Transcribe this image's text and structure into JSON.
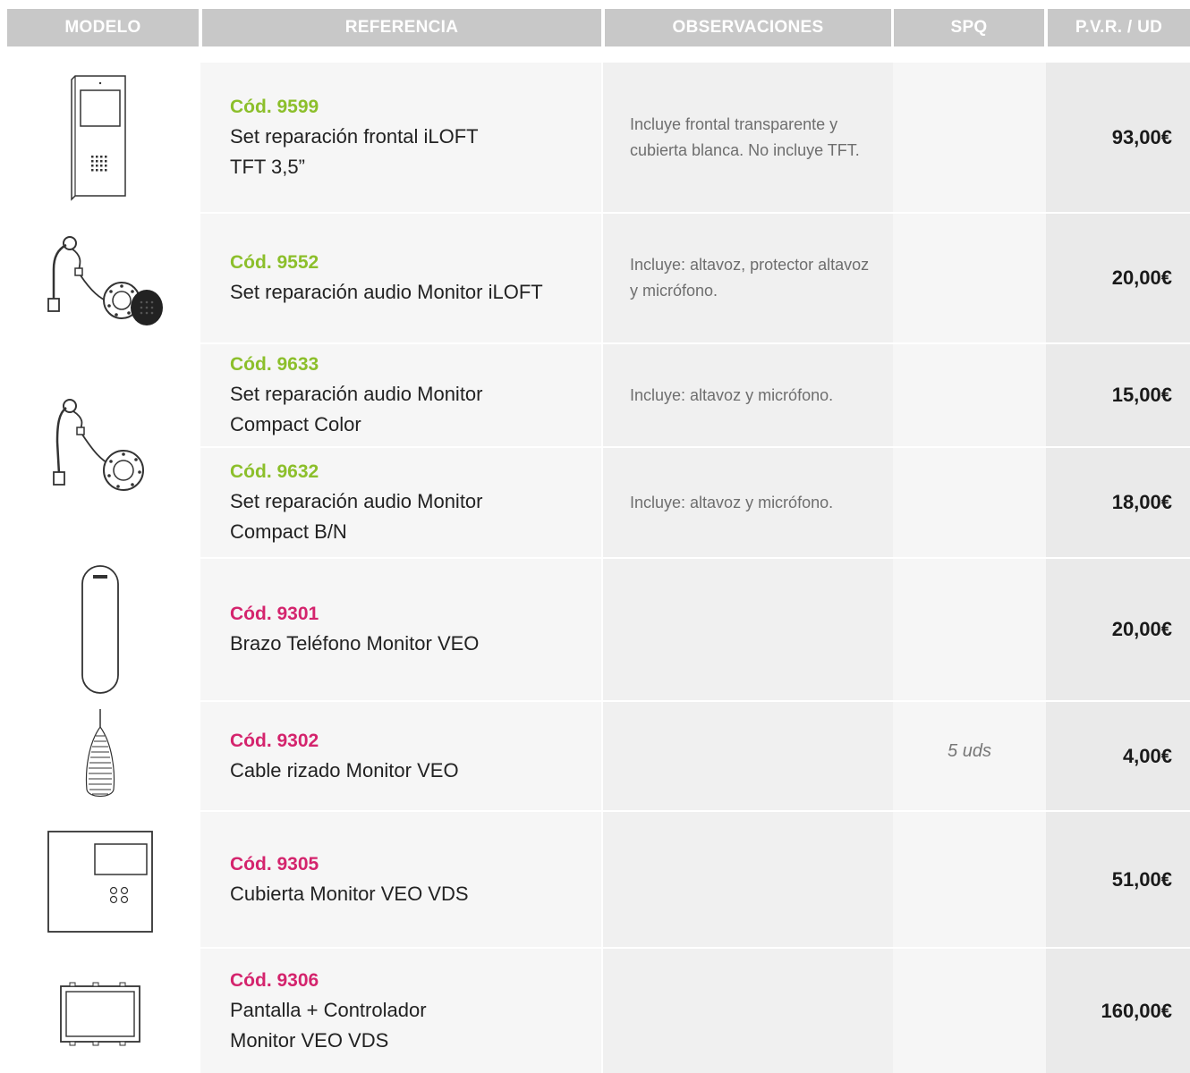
{
  "header": {
    "modelo": "MODELO",
    "referencia": "REFERENCIA",
    "observaciones": "OBSERVACIONES",
    "spq": "SPQ",
    "pvr": "P.V.R. / UD"
  },
  "colors": {
    "code_green": "#8cbf2b",
    "code_pink": "#d4246d",
    "header_bg": "#c8c8c8"
  },
  "products": [
    {
      "code": "Cód. 9599",
      "description": "Set reparación frontal iLOFT\nTFT 3,5”",
      "observations": "Incluye frontal transparente y cubierta blanca. No incluye TFT.",
      "spq": "",
      "price": "93,00€",
      "image": "front-panel-icon"
    },
    {
      "code": "Cód. 9552",
      "description": "Set reparación audio Monitor iLOFT",
      "observations": "Incluye: altavoz, protector altavoz y micrófono.",
      "spq": "",
      "price": "20,00€",
      "image": "speaker-cable-icon"
    },
    {
      "code": "Cód. 9633",
      "description": "Set reparación audio Monitor\nCompact Color",
      "observations": "Incluye: altavoz y micrófono.",
      "spq": "",
      "price": "15,00€",
      "image": "speaker-cable-icon"
    },
    {
      "code": "Cód. 9632",
      "description": "Set reparación audio Monitor\nCompact B/N",
      "observations": "Incluye: altavoz y micrófono.",
      "spq": "",
      "price": "18,00€",
      "image": "speaker-cable-icon"
    },
    {
      "code": "Cód. 9301",
      "description": "Brazo Teléfono Monitor VEO",
      "observations": "",
      "spq": "",
      "price": "20,00€",
      "image": "handset-icon"
    },
    {
      "code": "Cód. 9302",
      "description": "Cable rizado Monitor VEO",
      "observations": "",
      "spq": "5 uds",
      "price": "4,00€",
      "image": "coiled-cable-icon"
    },
    {
      "code": "Cód. 9305",
      "description": "Cubierta Monitor VEO VDS",
      "observations": "",
      "spq": "",
      "price": "51,00€",
      "image": "monitor-cover-icon"
    },
    {
      "code": "Cód. 9306",
      "description": "Pantalla + Controlador\nMonitor VEO VDS",
      "observations": "",
      "spq": "",
      "price": "160,00€",
      "image": "screen-controller-icon"
    }
  ]
}
